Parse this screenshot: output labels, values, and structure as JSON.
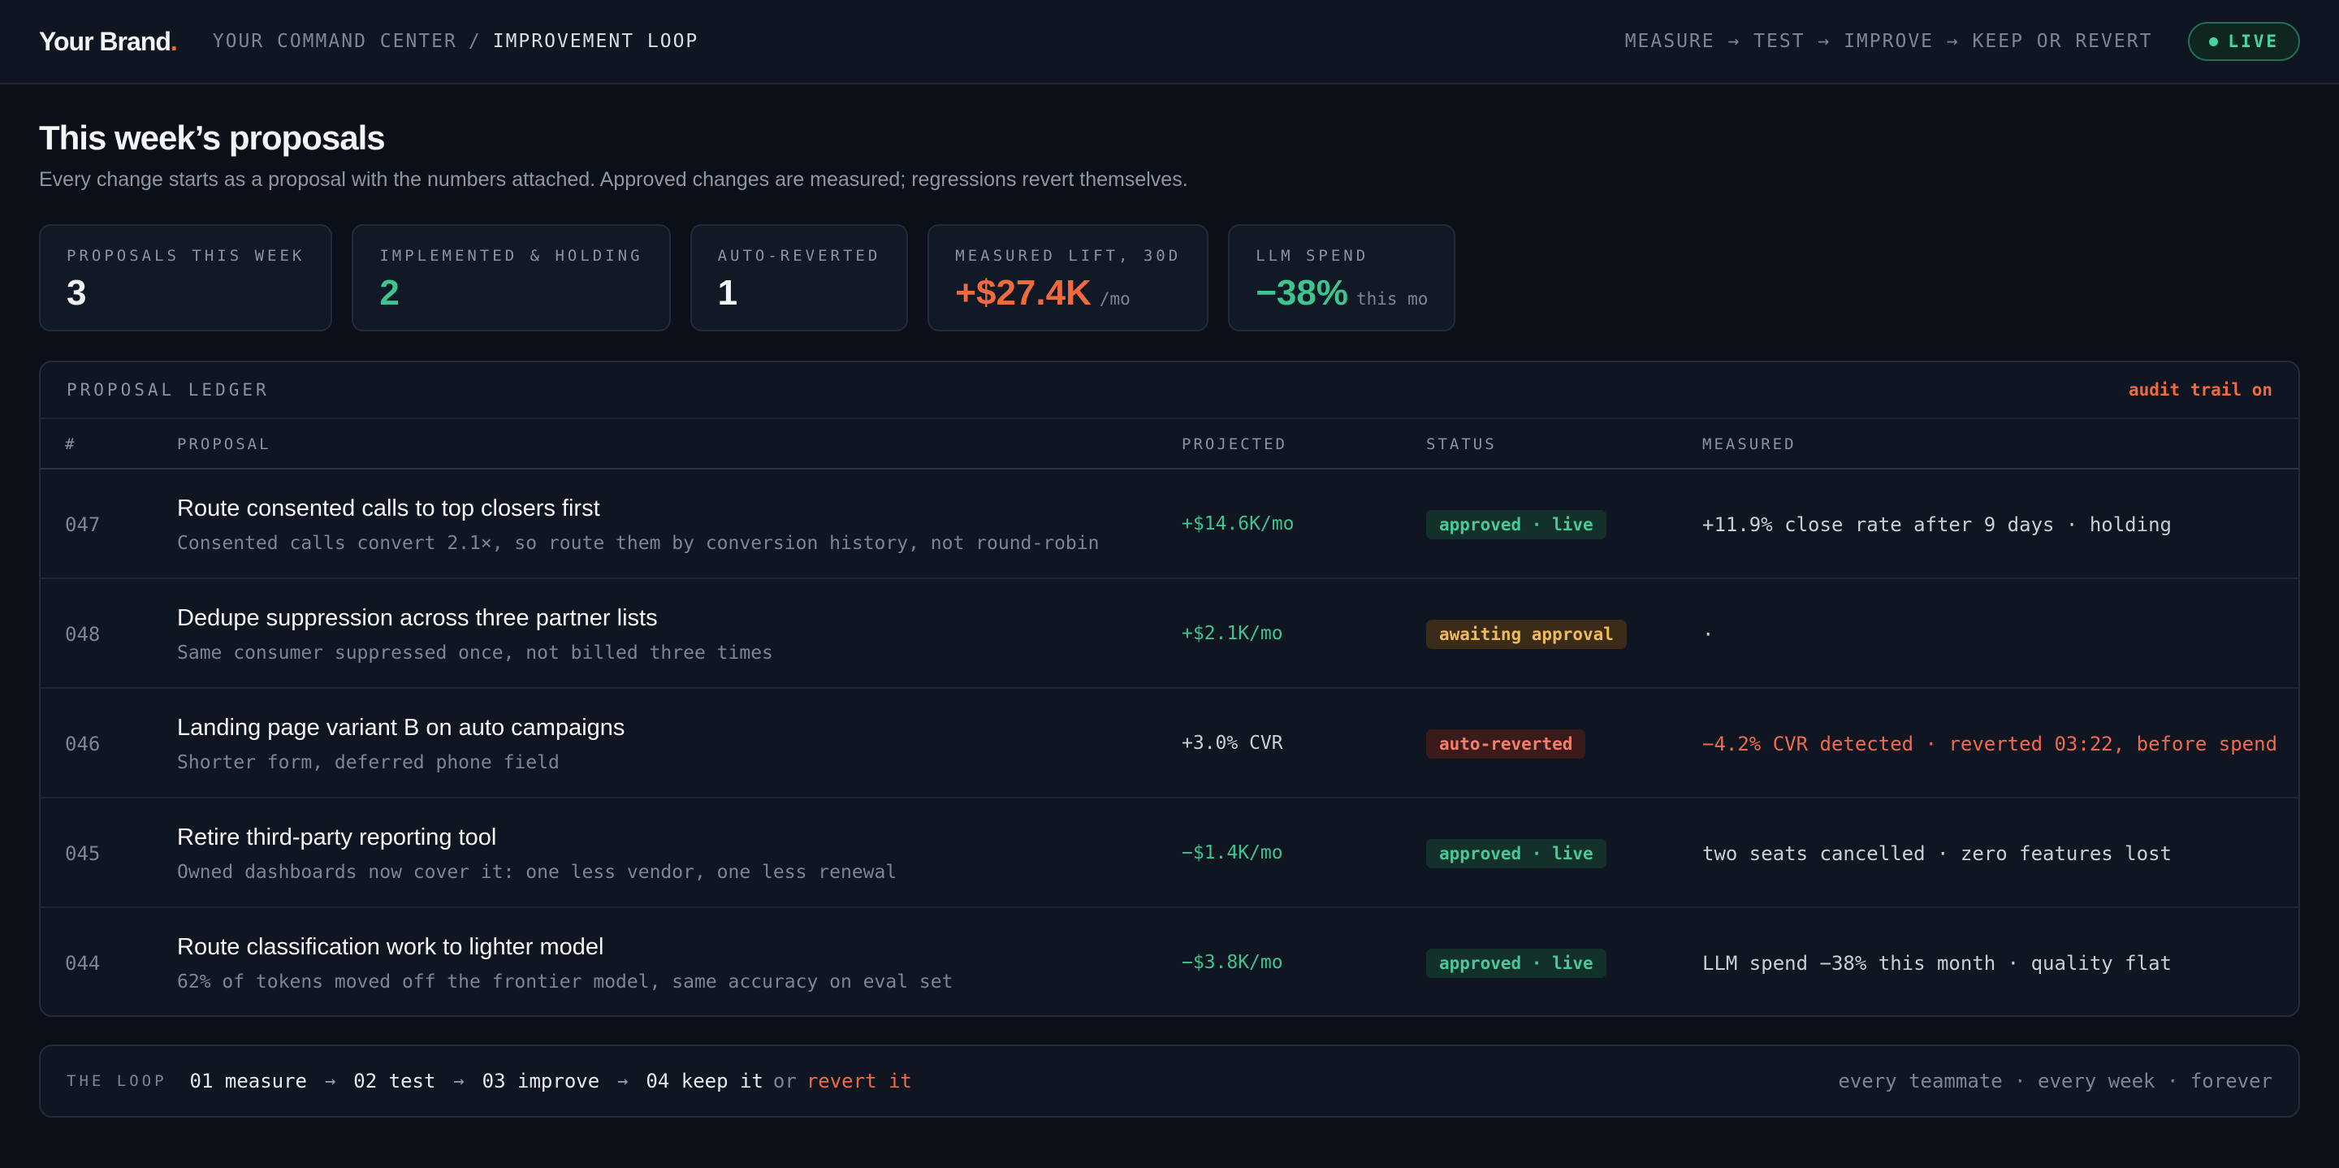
{
  "header": {
    "brand": "Your Brand",
    "brand_dot": ".",
    "breadcrumb_root": "YOUR COMMAND CENTER",
    "breadcrumb_sep": "/",
    "breadcrumb_current": "IMPROVEMENT LOOP",
    "loop_note": "MEASURE → TEST → IMPROVE → KEEP OR REVERT",
    "status": "LIVE"
  },
  "page": {
    "title": "This week’s proposals",
    "subtitle": "Every change starts as a proposal with the numbers attached. Approved changes are measured; regressions revert themselves."
  },
  "stats": [
    {
      "label": "PROPOSALS THIS WEEK",
      "value": "3",
      "unit": ""
    },
    {
      "label": "IMPLEMENTED & HOLDING",
      "value": "2",
      "unit": ""
    },
    {
      "label": "AUTO-REVERTED",
      "value": "1",
      "unit": ""
    },
    {
      "label": "MEASURED LIFT, 30D",
      "value": "+$27.4K",
      "unit": "/mo"
    },
    {
      "label": "LLM SPEND",
      "value": "−38%",
      "unit": "this mo"
    }
  ],
  "ledger": {
    "title": "PROPOSAL LEDGER",
    "audit": "audit trail on",
    "columns": {
      "num": "#",
      "proposal": "PROPOSAL",
      "projected": "PROJECTED",
      "status": "STATUS",
      "measured": "MEASURED"
    },
    "rows": [
      {
        "num": "047",
        "title": "Route consented calls to top closers first",
        "desc": "Consented calls convert 2.1×, so route them by conversion history, not round-robin",
        "projected": "+$14.6K/mo",
        "status": "approved · live",
        "measured": "+11.9% close rate after 9 days · holding"
      },
      {
        "num": "048",
        "title": "Dedupe suppression across three partner lists",
        "desc": "Same consumer suppressed once, not billed three times",
        "projected": "+$2.1K/mo",
        "status": "awaiting approval",
        "measured": "·"
      },
      {
        "num": "046",
        "title": "Landing page variant B on auto campaigns",
        "desc": "Shorter form, deferred phone field",
        "projected": "+3.0% CVR",
        "status": "auto-reverted",
        "measured": "−4.2% CVR detected · reverted 03:22, before spend"
      },
      {
        "num": "045",
        "title": "Retire third-party reporting tool",
        "desc": "Owned dashboards now cover it: one less vendor, one less renewal",
        "projected": "−$1.4K/mo",
        "status": "approved · live",
        "measured": "two seats cancelled · zero features lost"
      },
      {
        "num": "044",
        "title": "Route classification work to lighter model",
        "desc": "62% of tokens moved off the frontier model, same accuracy on eval set",
        "projected": "−$3.8K/mo",
        "status": "approved · live",
        "measured": "LLM spend −38% this month · quality flat"
      }
    ]
  },
  "loop": {
    "label": "THE LOOP",
    "steps": [
      "01 measure",
      "02 test",
      "03 improve",
      "04 keep it"
    ],
    "arrow": "→",
    "or": "or",
    "revert": "revert it",
    "tagline": "every teammate · every week · forever"
  },
  "colors": {
    "accent": "#f06a3e",
    "positive": "#3ec48e",
    "warning": "#f0b95a",
    "negative": "#f06a4e",
    "background": "#0b0f18"
  }
}
